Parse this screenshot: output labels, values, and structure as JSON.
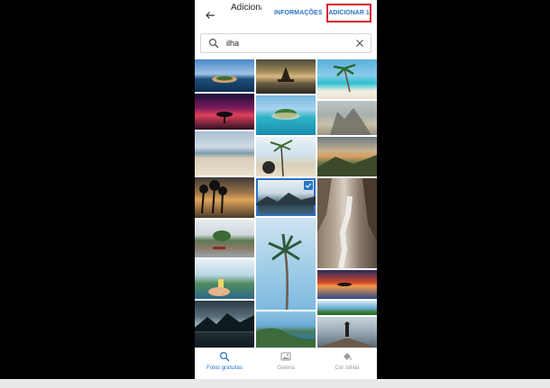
{
  "header": {
    "title": "Adicionar",
    "info_label": "INFORMAÇÕES",
    "add_label": "ADICIONAR 1"
  },
  "search": {
    "value": "ilha"
  },
  "photos": [
    {
      "desc": "island ocean aerial",
      "selected": false
    },
    {
      "desc": "temple island sunset",
      "selected": false
    },
    {
      "desc": "palm tree beach",
      "selected": false
    },
    {
      "desc": "tree red sunset",
      "selected": false
    },
    {
      "desc": "island turquoise lagoon",
      "selected": false
    },
    {
      "desc": "rocky island foggy",
      "selected": false
    },
    {
      "desc": "sand beach coast",
      "selected": false
    },
    {
      "desc": "person palm beach",
      "selected": false
    },
    {
      "desc": "island cliffs sunset",
      "selected": false
    },
    {
      "desc": "palm silhouettes sunset",
      "selected": false
    },
    {
      "desc": "mountain island sea",
      "selected": true
    },
    {
      "desc": "stone stairs cliffs",
      "selected": false
    },
    {
      "desc": "lake island landscape",
      "selected": false
    },
    {
      "desc": "palm tree sky",
      "selected": false
    },
    {
      "desc": "island reflection sunset",
      "selected": false
    },
    {
      "desc": "green island aerial",
      "selected": false
    },
    {
      "desc": "hand holding drink beach",
      "selected": false
    },
    {
      "desc": "mountains clouds",
      "selected": false
    },
    {
      "desc": "storm sky island",
      "selected": false
    },
    {
      "desc": "coastline blue sea",
      "selected": false
    },
    {
      "desc": "pier people",
      "selected": false
    }
  ],
  "nav": [
    {
      "label": "Fotos gratuitas",
      "icon": "search-icon",
      "active": true
    },
    {
      "label": "Galeria",
      "icon": "image-icon",
      "active": false
    },
    {
      "label": "Cor sólida",
      "icon": "paint-bucket-icon",
      "active": false
    }
  ],
  "colors": {
    "accent": "#2b73c7",
    "highlight_border": "#d9232e"
  }
}
